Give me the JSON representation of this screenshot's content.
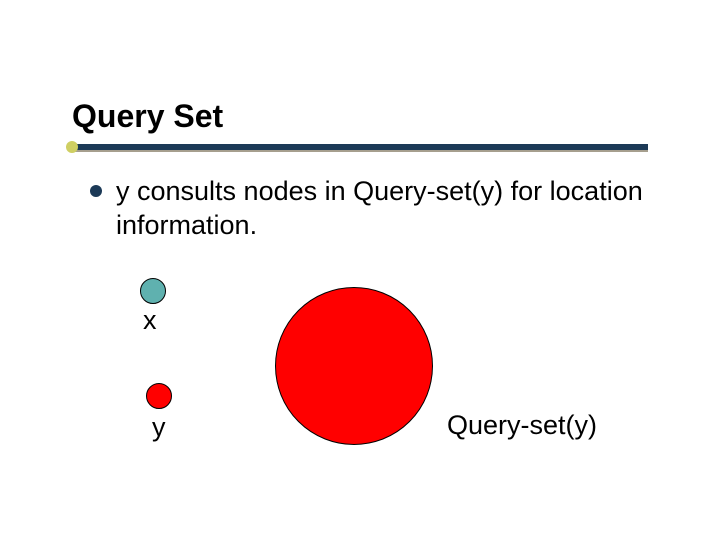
{
  "title": "Query Set",
  "bullet": "y consults nodes in Query-set(y) for location information.",
  "labels": {
    "x": "x",
    "y": "y",
    "queryset": "Query-set(y)"
  },
  "colors": {
    "rule": "#1c3a57",
    "accent_dot": "#cfcf63",
    "node_x": "#5fb1af",
    "node_y": "#ff0000",
    "queryset": "#ff0000"
  }
}
